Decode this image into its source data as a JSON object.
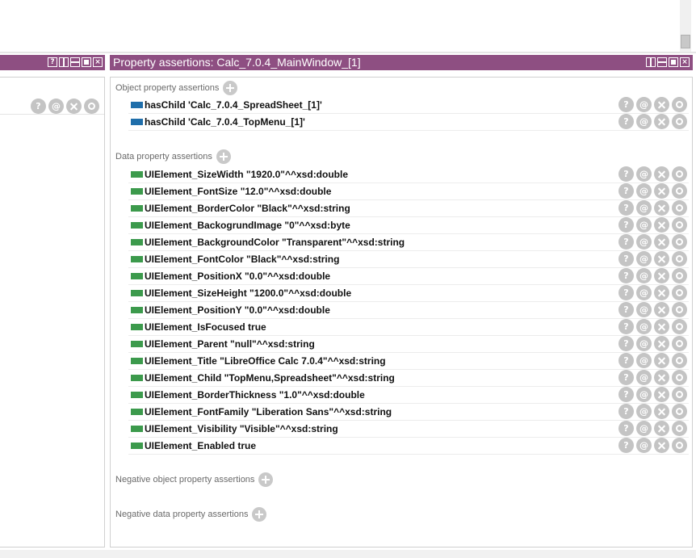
{
  "right_view": {
    "title": "Property assertions: Calc_7.0.4_MainWindow_[1]",
    "sections": {
      "object_property": {
        "label": "Object property assertions",
        "items": [
          {
            "text": "hasChild  'Calc_7.0.4_SpreadSheet_[1]'"
          },
          {
            "text": "hasChild  'Calc_7.0.4_TopMenu_[1]'"
          }
        ]
      },
      "data_property": {
        "label": "Data property assertions",
        "items": [
          {
            "text": "UIElement_SizeWidth  \"1920.0\"^^xsd:double"
          },
          {
            "text": "UIElement_FontSize  \"12.0\"^^xsd:double"
          },
          {
            "text": "UIElement_BorderColor  \"Black\"^^xsd:string"
          },
          {
            "text": "UIElement_BackogrundImage  \"0\"^^xsd:byte"
          },
          {
            "text": "UIElement_BackgroundColor  \"Transparent\"^^xsd:string"
          },
          {
            "text": "UIElement_FontColor  \"Black\"^^xsd:string"
          },
          {
            "text": "UIElement_PositionX  \"0.0\"^^xsd:double"
          },
          {
            "text": "UIElement_SizeHeight  \"1200.0\"^^xsd:double"
          },
          {
            "text": "UIElement_PositionY  \"0.0\"^^xsd:double"
          },
          {
            "text": "UIElement_IsFocused  true"
          },
          {
            "text": "UIElement_Parent  \"null\"^^xsd:string"
          },
          {
            "text": "UIElement_Title  \"LibreOffice Calc 7.0.4\"^^xsd:string"
          },
          {
            "text": "UIElement_Child  \"TopMenu,Spreadsheet\"^^xsd:string"
          },
          {
            "text": "UIElement_BorderThickness  \"1.0\"^^xsd:double"
          },
          {
            "text": "UIElement_FontFamily  \"Liberation Sans\"^^xsd:string"
          },
          {
            "text": "UIElement_Visibility  \"Visible\"^^xsd:string"
          },
          {
            "text": "UIElement_Enabled  true"
          }
        ]
      },
      "negative_object_property": {
        "label": "Negative object property assertions"
      },
      "negative_data_property": {
        "label": "Negative data property assertions"
      }
    }
  },
  "action_glyphs": {
    "explain": "?",
    "annotate": "@"
  },
  "icons": {
    "add": "plus-circle-icon",
    "explain": "question-icon",
    "annotate": "at-icon",
    "delete": "x-icon",
    "edit": "circle-icon"
  },
  "colors": {
    "titlebar": "#8e4f82",
    "object_property_swatch": "#1f6eaa",
    "data_property_swatch": "#3c9a4c",
    "action_button": "#c4c4c4"
  }
}
